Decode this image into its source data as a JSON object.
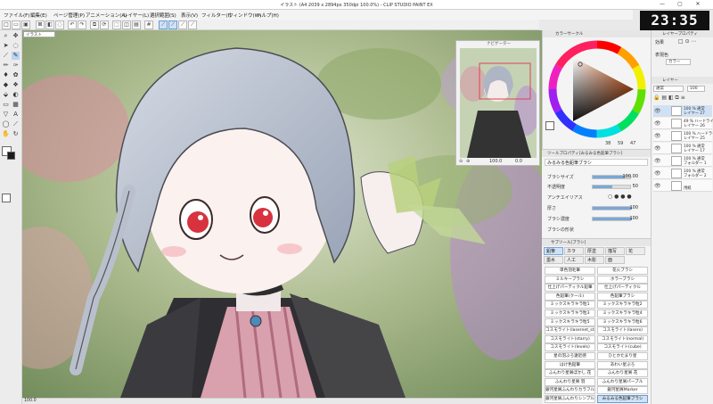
{
  "window": {
    "title": "イラスト (A4 2039 x 2894px 350dpi 100.0%) - CLIP STUDIO PAINT EX",
    "controls": [
      "—",
      "▢",
      "✕"
    ]
  },
  "clock": "23:35",
  "menu": [
    "ファイル(F)",
    "編集(E)",
    "ページ管理(P)",
    "アニメーション(A)",
    "レイヤー(L)",
    "選択範囲(S)",
    "表示(V)",
    "フィルター(I)",
    "ウィンドウ(W)",
    "ヘルプ(H)"
  ],
  "document_tab": "イラスト",
  "navigator": {
    "header": "ナビゲーター",
    "zoom": "100.0",
    "angle": "0.0",
    "icons": [
      "zoom-out",
      "zoom-in",
      "fit",
      "rotate"
    ]
  },
  "color_panel": {
    "header": "カラーサークル",
    "h": "38",
    "s": "59",
    "v": "47",
    "main_color": "#e8641e"
  },
  "tool_property": {
    "header": "ツールプロパティ[みるみる色鉛筆ブラシ]",
    "brush_name": "みるみる色鉛筆ブラシ",
    "props": [
      {
        "label": "ブラシサイズ",
        "value": "100.00",
        "fill": 0.82
      },
      {
        "label": "不透明度",
        "value": "50",
        "fill": 0.5
      },
      {
        "label": "アンチエイリアス",
        "value": "",
        "fill": 0.0
      },
      {
        "label": "厚さ",
        "value": "100",
        "fill": 1.0
      },
      {
        "label": "ブラシ濃度",
        "value": "100",
        "fill": 1.0
      },
      {
        "label": "ブラシの形状",
        "value": "",
        "fill": 0.0
      }
    ]
  },
  "sub_tool": {
    "header": "サブツール[ブラシ]",
    "tabs": [
      "鉛筆",
      "カラ",
      "厚塗",
      "描写",
      "花"
    ],
    "tabs2": [
      "墨水",
      "人工",
      "木彫",
      "面"
    ],
    "brushes": [
      [
        "単色羽毛筆",
        "花火ブラシ"
      ],
      [
        "ミルキーブラシ",
        "ホラーブラシ"
      ],
      [
        "仕上げパーティクル鉛筆",
        "仕上げパーティクル"
      ],
      [
        "色鉛筆(クール)",
        "色鉛筆ブラシ"
      ],
      [
        "ミックスキラキラ粒1",
        "ミックスキラキラ粒2"
      ],
      [
        "ミックスキラキラ粒3",
        "ミックスキラキラ粒4"
      ],
      [
        "ミックスキラキラ粒5",
        "ミックスキラキラ粒6"
      ],
      [
        "コスモライト(lasernet_starry)",
        "コスモライト(laserx)"
      ],
      [
        "コスモライト(starry)",
        "コスモライト(normal)"
      ],
      [
        "コスモライト(levels)",
        "コスモライト(cube)"
      ],
      [
        "星の羽ぶろ遠近感",
        "ひとかたまり星"
      ],
      [
        "はけ色鉛筆",
        "あわい星ぶろ"
      ],
      [
        "ふんわり星屑ぼかし 花",
        "ふんわり星屑 花"
      ],
      [
        "ふんわり星屑 羽",
        "ふんわり星屑パープル"
      ],
      [
        "銀河星屑ふんわりカラフル",
        "銀河星屑Marker"
      ],
      [
        "銀河星屑ふんわりシンプル",
        "みるみる色鉛筆ブラシ"
      ]
    ],
    "selected_brush": "みるみる色鉛筆ブラシ"
  },
  "right_panel": {
    "property_header": "レイヤープロパティ",
    "effect_label": "効果",
    "expression_label": "表現色",
    "expression_value": "カラー",
    "layer_header": "レイヤー",
    "blend_mode": "通常",
    "opacity": "100",
    "layers": [
      {
        "line1": "100 % 通常",
        "line2": "レイヤー 27",
        "selected": true
      },
      {
        "line1": "49 % ハードライト",
        "line2": "レイヤー 26",
        "selected": false
      },
      {
        "line1": "100 % ハードライト",
        "line2": "レイヤー 25",
        "selected": false
      },
      {
        "line1": "100 % 通常",
        "line2": "レイヤー 17",
        "selected": false
      },
      {
        "line1": "100 % 通常",
        "line2": "フォルダー 1",
        "selected": false
      },
      {
        "line1": "100 % 通常",
        "line2": "フォルダー 2",
        "selected": false
      },
      {
        "line1": "",
        "line2": "用紙",
        "selected": false
      }
    ]
  },
  "status": {
    "zoom": "100.0"
  }
}
